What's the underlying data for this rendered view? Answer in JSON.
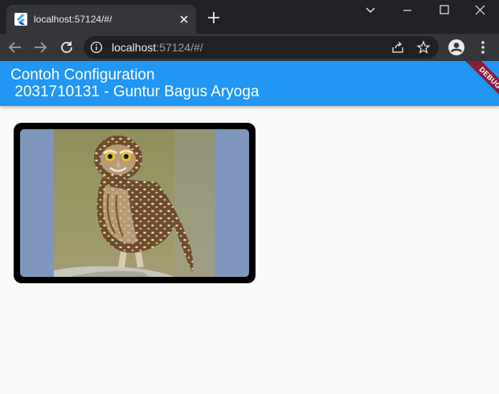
{
  "browser": {
    "tab": {
      "title": "localhost:57124/#/",
      "favicon": "flutter-icon"
    },
    "url": {
      "host": "localhost",
      "rest": ":57124/#/"
    }
  },
  "appbar": {
    "title": "Contoh Configuration\n 2031710131 - Guntur Bagus Aryoga",
    "debug_banner": "DEBUG"
  },
  "colors": {
    "appbar": "#2196f3",
    "background": "#fafafa",
    "card_border": "#000000",
    "photo_fill": "#7f97bc"
  }
}
